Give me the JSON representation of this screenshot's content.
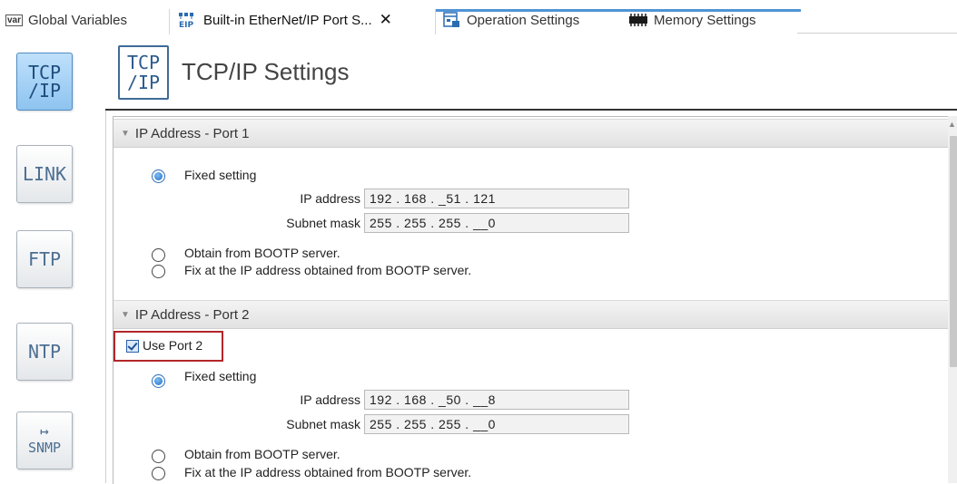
{
  "tabs": [
    {
      "label": "Global Variables",
      "icon": "var-icon",
      "icon_text": "var"
    },
    {
      "label": "Built-in EtherNet/IP Port S...",
      "icon": "ethernet-ip-icon",
      "active": true
    },
    {
      "label": "Operation Settings",
      "icon": "operation-icon"
    },
    {
      "label": "Memory Settings",
      "icon": "memory-icon"
    }
  ],
  "close_glyph": "✕",
  "rail": {
    "items": [
      {
        "label_top": "TCP",
        "label_bottom": "/IP",
        "selected": true
      },
      {
        "label_top": "LINK",
        "label_bottom": ""
      },
      {
        "label_top": "FTP",
        "label_bottom": ""
      },
      {
        "label_top": "NTP",
        "label_bottom": ""
      },
      {
        "label_top": "SNMP",
        "label_bottom": "",
        "icon": "arrow-right-icon"
      }
    ]
  },
  "header": {
    "icon_top": "TCP",
    "icon_bottom": "/IP",
    "title": "TCP/IP Settings"
  },
  "port1": {
    "section_title": "IP Address - Port 1",
    "fixed_label": "Fixed setting",
    "fixed_selected": true,
    "ip_label": "IP address",
    "ip_value": "192 . 168 . _51 . 121",
    "mask_label": "Subnet mask",
    "mask_value": "255 . 255 . 255 . __0",
    "bootp_label": "Obtain from BOOTP server.",
    "fix_bootp_label": "Fix at the IP address obtained from BOOTP server."
  },
  "port2": {
    "section_title": "IP Address - Port 2",
    "use_port_label": "Use Port 2",
    "use_port_checked": true,
    "fixed_label": "Fixed setting",
    "fixed_selected": true,
    "ip_label": "IP address",
    "ip_value": "192 . 168 . _50 . __8",
    "mask_label": "Subnet mask",
    "mask_value": "255 . 255 . 255 . __0",
    "bootp_label": "Obtain from BOOTP server.",
    "fix_bootp_label": "Fix at the IP address obtained from BOOTP server."
  },
  "colors": {
    "accent": "#4f93d6",
    "highlight_border": "#b3262a",
    "rail_selected": "#8ec4f0"
  }
}
